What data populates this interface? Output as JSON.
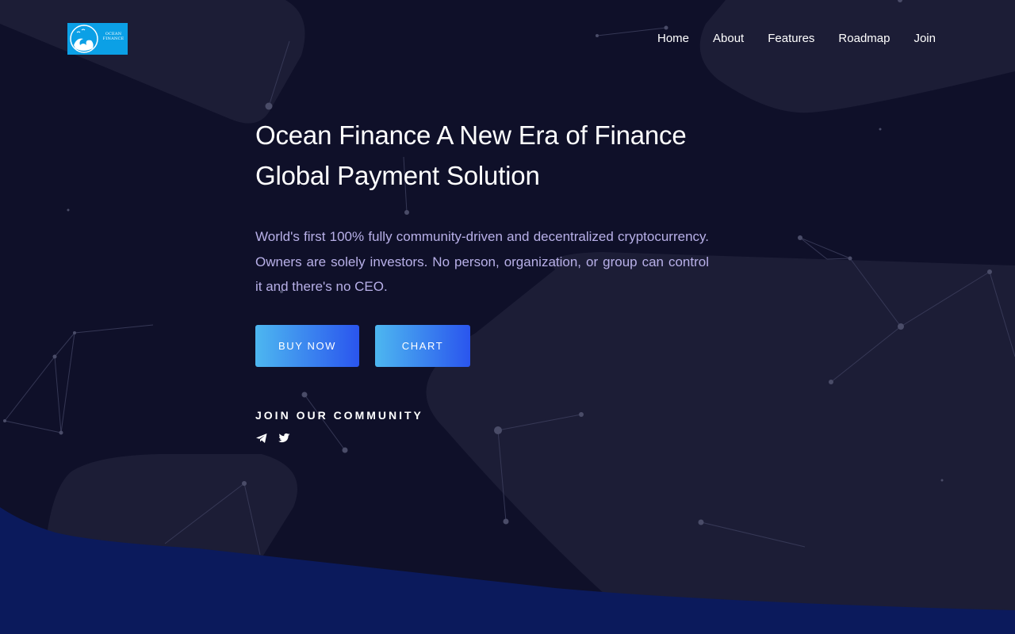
{
  "brand": {
    "logo_text": "OCEAN FINANCE"
  },
  "nav": {
    "items": [
      {
        "label": "Home"
      },
      {
        "label": "About"
      },
      {
        "label": "Features"
      },
      {
        "label": "Roadmap"
      },
      {
        "label": "Join"
      }
    ]
  },
  "hero": {
    "title_line1": "Ocean Finance A New Era of Finance",
    "title_line2": "Global Payment Solution",
    "description": "World's first 100% fully community-driven and decentralized cryptocurrency. Owners are solely investors. No person, organization, or group can control it and there's no CEO.",
    "buy_label": "BUY NOW",
    "chart_label": "CHART"
  },
  "community": {
    "title": "JOIN OUR COMMUNITY",
    "icons": [
      "telegram-icon",
      "twitter-icon"
    ]
  },
  "colors": {
    "background": "#0f1029",
    "blob": "#1c1d36",
    "wave": "#0b1a5c",
    "text_light": "#ffffff",
    "text_muted": "#b8b0e8",
    "button_start": "#4db7f0",
    "button_end": "#2a55ee",
    "logo_bg": "#0ba0e6"
  }
}
